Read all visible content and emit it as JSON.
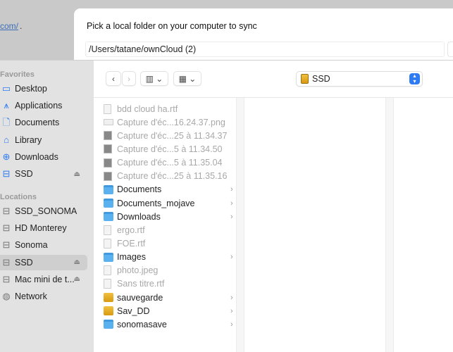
{
  "background": {
    "link_text": "com/",
    "trailing": "."
  },
  "dialog": {
    "prompt": "Pick a local folder on your computer to sync",
    "path_value": "/Users/tatane/ownCloud (2)"
  },
  "sidebar": {
    "favorites_label": "Favorites",
    "favorites": [
      {
        "label": "Desktop",
        "icon": "desktop-icon"
      },
      {
        "label": "Applications",
        "icon": "applications-icon"
      },
      {
        "label": "Documents",
        "icon": "document-icon"
      },
      {
        "label": "Library",
        "icon": "library-icon"
      },
      {
        "label": "Downloads",
        "icon": "download-icon"
      },
      {
        "label": "SSD",
        "icon": "drive-icon",
        "eject": true
      }
    ],
    "locations_label": "Locations",
    "locations": [
      {
        "label": "SSD_SONOMA"
      },
      {
        "label": "HD Monterey"
      },
      {
        "label": "Sonoma"
      },
      {
        "label": "SSD",
        "selected": true,
        "eject": true
      },
      {
        "label": "Mac mini de t...",
        "eject": true
      },
      {
        "label": "Network"
      }
    ]
  },
  "toolbar": {
    "back": "‹",
    "forward": "›",
    "location": "SSD"
  },
  "files": [
    {
      "name": "bdd cloud ha.rtf",
      "type": "doc",
      "dim": true
    },
    {
      "name": "Capture d'éc...16.24.37.png",
      "type": "png",
      "dim": true
    },
    {
      "name": "Capture d'éc...25 à 11.34.37",
      "type": "img",
      "dim": true
    },
    {
      "name": "Capture d'éc...5 à 11.34.50",
      "type": "img",
      "dim": true
    },
    {
      "name": "Capture d'éc...5 à 11.35.04",
      "type": "img",
      "dim": true
    },
    {
      "name": "Capture d'éc...25 à 11.35.16",
      "type": "img",
      "dim": true
    },
    {
      "name": "Documents",
      "type": "folder"
    },
    {
      "name": "Documents_mojave",
      "type": "folder"
    },
    {
      "name": "Downloads",
      "type": "folder"
    },
    {
      "name": "ergo.rtf",
      "type": "doc",
      "dim": true
    },
    {
      "name": "FOE.rtf",
      "type": "doc",
      "dim": true
    },
    {
      "name": "Images",
      "type": "folder"
    },
    {
      "name": "photo.jpeg",
      "type": "doc",
      "dim": true
    },
    {
      "name": "Sans titre.rtf",
      "type": "doc",
      "dim": true
    },
    {
      "name": "sauvegarde",
      "type": "drive"
    },
    {
      "name": "Sav_DD",
      "type": "drive"
    },
    {
      "name": "sonomasave",
      "type": "folder"
    }
  ],
  "colors": {
    "accent": "#2f7bf2",
    "sidebar": "#e2e2e2",
    "folder": "#5ab1ef"
  }
}
